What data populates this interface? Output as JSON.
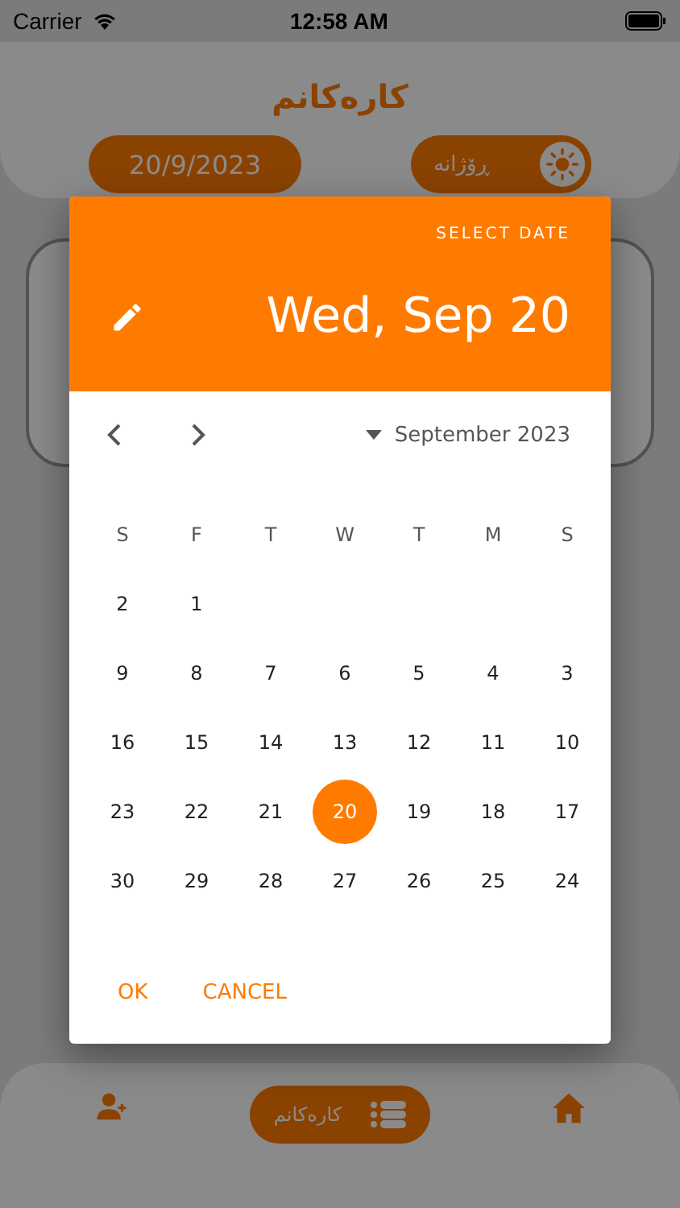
{
  "status_bar": {
    "carrier": "Carrier",
    "time": "12:58 AM"
  },
  "header": {
    "title": "کارەکانم",
    "date": "20/9/2023",
    "mode_label": "ڕۆژانە"
  },
  "date_picker": {
    "caption": "SELECT DATE",
    "selected_date": "Wed, Sep 20",
    "month_label": "September 2023",
    "weekdays": [
      "S",
      "F",
      "T",
      "W",
      "T",
      "M",
      "S"
    ],
    "weeks": [
      [
        {
          "day": "2",
          "selected": false
        },
        {
          "day": "1",
          "selected": false
        }
      ],
      [
        {
          "day": "9",
          "selected": false
        },
        {
          "day": "8",
          "selected": false
        },
        {
          "day": "7",
          "selected": false
        },
        {
          "day": "6",
          "selected": false
        },
        {
          "day": "5",
          "selected": false
        },
        {
          "day": "4",
          "selected": false
        },
        {
          "day": "3",
          "selected": false
        }
      ],
      [
        {
          "day": "16",
          "selected": false
        },
        {
          "day": "15",
          "selected": false
        },
        {
          "day": "14",
          "selected": false
        },
        {
          "day": "13",
          "selected": false
        },
        {
          "day": "12",
          "selected": false
        },
        {
          "day": "11",
          "selected": false
        },
        {
          "day": "10",
          "selected": false
        }
      ],
      [
        {
          "day": "23",
          "selected": false
        },
        {
          "day": "22",
          "selected": false
        },
        {
          "day": "21",
          "selected": false
        },
        {
          "day": "20",
          "selected": true
        },
        {
          "day": "19",
          "selected": false
        },
        {
          "day": "18",
          "selected": false
        },
        {
          "day": "17",
          "selected": false
        }
      ],
      [
        {
          "day": "30",
          "selected": false
        },
        {
          "day": "29",
          "selected": false
        },
        {
          "day": "28",
          "selected": false
        },
        {
          "day": "27",
          "selected": false
        },
        {
          "day": "26",
          "selected": false
        },
        {
          "day": "25",
          "selected": false
        },
        {
          "day": "24",
          "selected": false
        }
      ]
    ],
    "buttons": [
      "OK",
      "CANCEL"
    ]
  },
  "bottom_nav": {
    "active_label": "کارەکانم"
  }
}
